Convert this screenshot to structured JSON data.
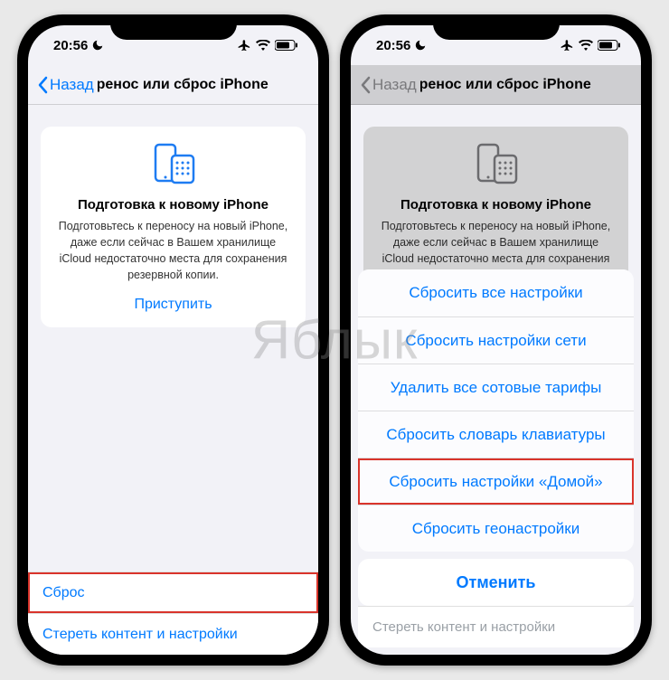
{
  "watermark": "Яблык",
  "status": {
    "time": "20:56"
  },
  "nav": {
    "back": "Назад",
    "title": "Перенос или сброс iPhone"
  },
  "card": {
    "title": "Подготовка к новому iPhone",
    "body": "Подготовьтесь к переносу на новый iPhone, даже если сейчас в Вашем хранилище iCloud недостаточно места для сохранения резервной копии.",
    "action": "Приступить"
  },
  "rows": {
    "reset": "Сброс",
    "erase": "Стереть контент и настройки"
  },
  "sheet": {
    "options": [
      "Сбросить все настройки",
      "Сбросить настройки сети",
      "Удалить все сотовые тарифы",
      "Сбросить словарь клавиатуры",
      "Сбросить настройки «Домой»",
      "Сбросить геонастройки"
    ],
    "cancel": "Отменить"
  }
}
